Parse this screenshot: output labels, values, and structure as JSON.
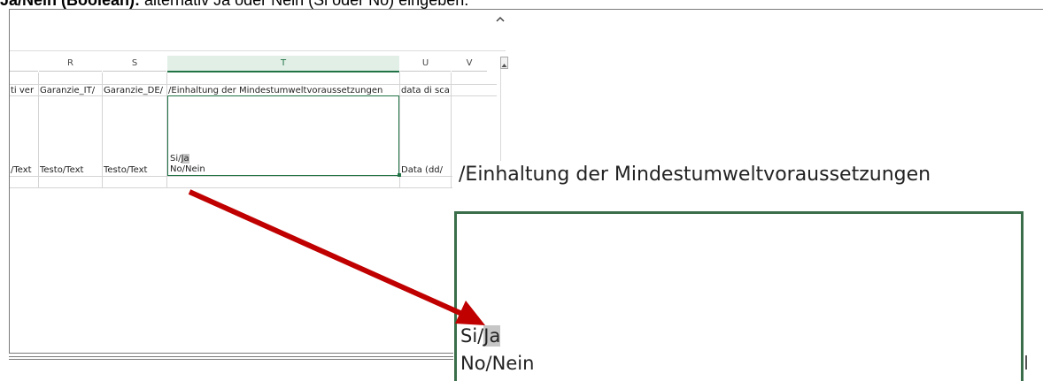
{
  "caption": {
    "bold": "Ja/Nein (Boolean):",
    "rest": " alternativ Ja oder Nein (Si oder No) eingeben."
  },
  "columns": [
    "R",
    "S",
    "T",
    "U",
    "V"
  ],
  "header_row": {
    "q": "ti ver",
    "r": "Garanzie_IT/",
    "s": "Garanzie_DE/",
    "t": "/Einhaltung der Mindestumweltvoraussetzungen",
    "u": "data di sca"
  },
  "type_row": {
    "q": "/Text",
    "r": "Testo/Text",
    "s": "Testo/Text",
    "t_line1_a": "Si/",
    "t_line1_b": "Ja",
    "t_line2": "No/Nein",
    "u": "Data (dd/"
  },
  "zoom": {
    "header": "/Einhaltung der Mindestumweltvoraussetzungen",
    "line1_a": "Si/",
    "line1_b": "Ja",
    "line2": "No/Nein"
  },
  "colors": {
    "selection": "#217346",
    "arrow": "#c00000",
    "highlight": "#c6c6c6"
  }
}
